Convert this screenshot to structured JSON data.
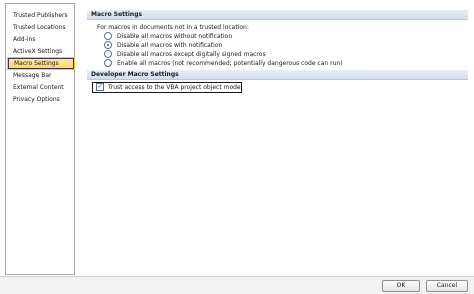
{
  "sidebar": {
    "items": [
      {
        "label": "Trusted Publishers",
        "selected": false
      },
      {
        "label": "Trusted Locations",
        "selected": false
      },
      {
        "label": "Add-ins",
        "selected": false
      },
      {
        "label": "ActiveX Settings",
        "selected": false
      },
      {
        "label": "Macro Settings",
        "selected": true
      },
      {
        "label": "Message Bar",
        "selected": false
      },
      {
        "label": "External Content",
        "selected": false
      },
      {
        "label": "Privacy Options",
        "selected": false
      }
    ]
  },
  "macro_settings": {
    "header": "Macro Settings",
    "intro": "For macros in documents not in a trusted location:",
    "options": [
      {
        "label": "Disable all macros without notification",
        "selected": false
      },
      {
        "label": "Disable all macros with notification",
        "selected": true
      },
      {
        "label": "Disable all macros except digitally signed macros",
        "selected": false
      },
      {
        "label": "Enable all macros (not recommended; potentially dangerous code can run)",
        "selected": false
      }
    ]
  },
  "developer_settings": {
    "header": "Developer Macro Settings",
    "trust_vba_label": "Trust access to the VBA project object model",
    "trust_vba_checked": true
  },
  "buttons": {
    "ok": "OK",
    "cancel": "Cancel"
  }
}
